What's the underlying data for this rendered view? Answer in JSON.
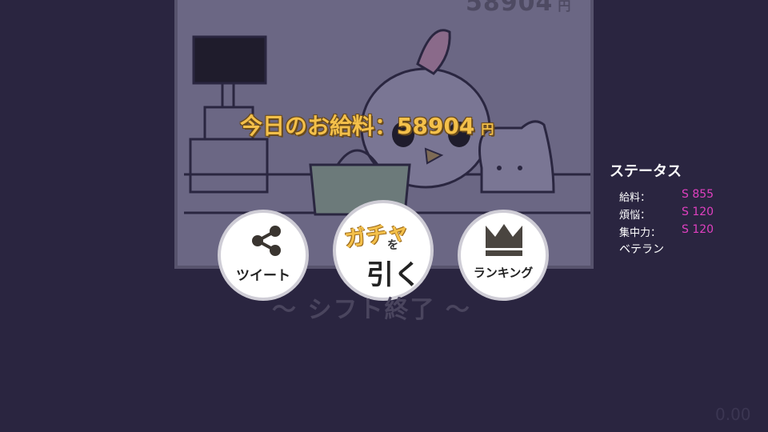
{
  "game": {
    "top_score": "58904",
    "top_score_unit": "円",
    "salary_label": "今日のお給料：58904",
    "salary_unit": "円",
    "shift_end": "〜 シフト終了 〜",
    "timer": "0.00"
  },
  "buttons": {
    "tweet_label": "ツイート",
    "gacha_top": "ガチャ",
    "gacha_wo": "を",
    "gacha_bottom": "引く",
    "ranking_label": "ランキング"
  },
  "status": {
    "title": "ステータス",
    "rows": [
      {
        "label": "給料：",
        "value": "S 855"
      },
      {
        "label": "煩悩：",
        "value": "S 120"
      },
      {
        "label": "集中力：",
        "value": "S 120"
      }
    ],
    "rank": "ベテラン"
  },
  "colors": {
    "background": "#2a2540",
    "panel": "#6b6784",
    "salary_text": "#f4c04a",
    "status_value": "#e040c0"
  },
  "icons": [
    "share-icon",
    "crown-icon"
  ]
}
